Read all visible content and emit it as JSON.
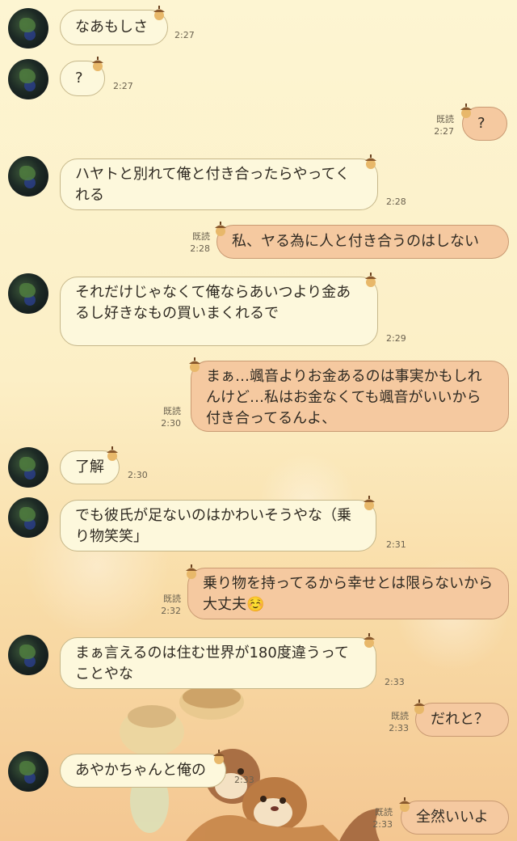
{
  "read_label": "既読",
  "messages": [
    {
      "text": "なあもしさ",
      "time": "2:27"
    },
    {
      "text": "?",
      "time": "2:27"
    },
    {
      "text": "?",
      "time": "2:27"
    },
    {
      "text": "ハヤトと別れて俺と付き合ったらやってくれる",
      "time": "2:28"
    },
    {
      "text": "私、ヤる為に人と付き合うのはしない",
      "time": "2:28"
    },
    {
      "text": "それだけじゃなくて俺ならあいつより金あるし好きなもの買いまくれるで",
      "time": "2:29"
    },
    {
      "text": "まぁ…颯音よりお金あるのは事実かもしれんけど…私はお金なくても颯音がいいから付き合ってるんよ、",
      "time": "2:30"
    },
    {
      "text": "了解",
      "time": "2:30"
    },
    {
      "text": "でも彼氏が足ないのはかわいそうやな（乗り物笑笑」",
      "time": "2:31"
    },
    {
      "text": "乗り物を持ってるから幸せとは限らないから大丈夫☺️",
      "time": "2:32"
    },
    {
      "text": "まぁ言えるのは住む世界が180度違うってことやな",
      "time": "2:33"
    },
    {
      "text": "だれと？",
      "time": "2:33"
    },
    {
      "text": "あやかちゃんと俺の",
      "time": "2:33"
    },
    {
      "text": "全然いいよ",
      "time": "2:33"
    }
  ]
}
